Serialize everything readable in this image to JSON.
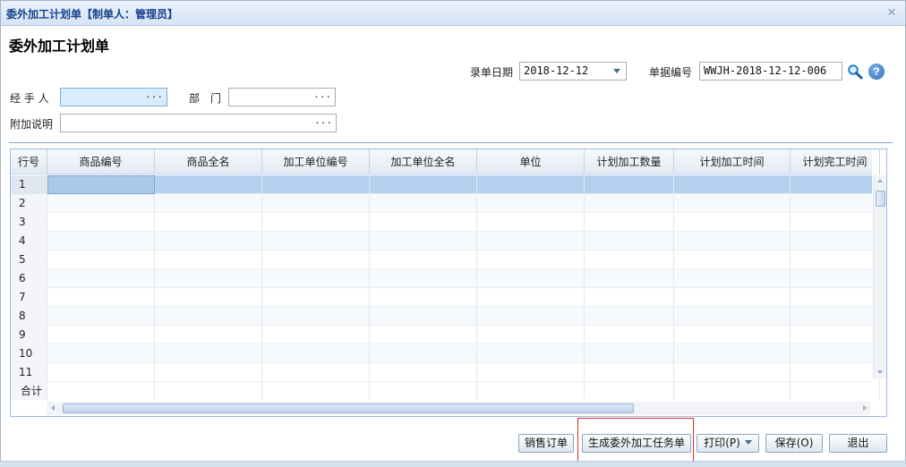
{
  "window": {
    "title": "委外加工计划单【制单人：管理员】",
    "close_glyph": "✕"
  },
  "page": {
    "heading": "委外加工计划单"
  },
  "form": {
    "entry_date_label": "录单日期",
    "entry_date_value": "2018-12-12",
    "doc_no_label": "单据编号",
    "doc_no_value": "WWJH-2018-12-12-006",
    "handler_label": "经 手 人",
    "handler_value": "",
    "dept_label": "部　门",
    "dept_value": "",
    "remark_label": "附加说明",
    "remark_value": "",
    "picker_glyph": "···"
  },
  "icons": {
    "search": "search-icon",
    "help": "help-icon",
    "help_glyph": "?"
  },
  "grid": {
    "columns": [
      "行号",
      "商品编号",
      "商品全名",
      "加工单位编号",
      "加工单位全名",
      "单位",
      "计划加工数量",
      "计划加工时间",
      "计划完工时间"
    ],
    "rows": [
      {
        "no": "1"
      },
      {
        "no": "2"
      },
      {
        "no": "3"
      },
      {
        "no": "4"
      },
      {
        "no": "5"
      },
      {
        "no": "6"
      },
      {
        "no": "7"
      },
      {
        "no": "8"
      },
      {
        "no": "9"
      },
      {
        "no": "10"
      },
      {
        "no": "11"
      }
    ],
    "selected_row": 1,
    "summary_label": "合计"
  },
  "buttons": {
    "sales_order": "销售订单",
    "generate_task": "生成委外加工任务单",
    "print": "打印(P)",
    "save": "保存(O)",
    "exit": "退出"
  },
  "colors": {
    "title_text": "#15428b",
    "selection": "#b3d0ef",
    "highlight_box": "#e02b2b"
  }
}
